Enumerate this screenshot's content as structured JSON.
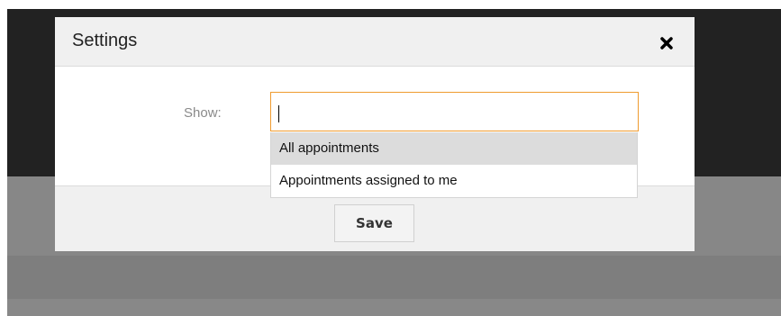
{
  "dialog": {
    "title": "Settings",
    "close_icon": "close-icon",
    "fields": {
      "show_label": "Show:",
      "show_value": ""
    },
    "dropdown": {
      "options": [
        {
          "label": "All appointments",
          "highlighted": true
        },
        {
          "label": "Appointments assigned to me",
          "highlighted": false
        }
      ]
    },
    "footer": {
      "save_label": "Save"
    }
  },
  "colors": {
    "input_focus_border": "#ef9b2f",
    "highlight": "#dcdcdc",
    "overlay_dark": "#222222",
    "overlay_gray": "#878787"
  }
}
